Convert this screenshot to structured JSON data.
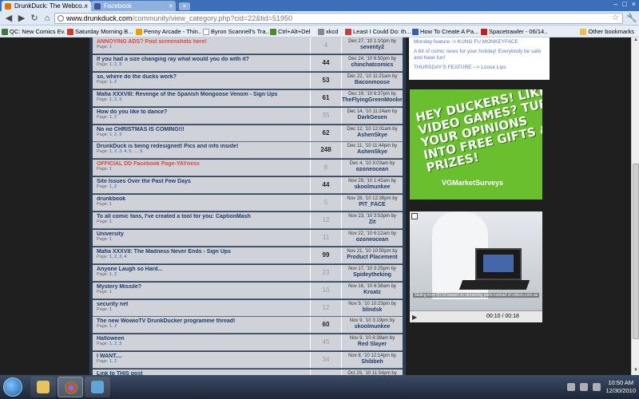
{
  "browser": {
    "tabs": [
      {
        "label": "DrunkDuck: The Webco...",
        "active": true
      },
      {
        "label": "Facebook",
        "active": false
      }
    ],
    "new_tab": "+",
    "url_host": "www.drunkduck.com",
    "url_path": "/community/view_category.php?cid=22&tid=51950"
  },
  "bookmarks": [
    {
      "label": "QC: New Comics Ev...",
      "color": "#3b7a3b"
    },
    {
      "label": "Saturday Morning B...",
      "color": "#d23a2a"
    },
    {
      "label": "Penny Arcade - Thin...",
      "color": "#e6a200"
    },
    {
      "label": "Byron Scannell's Tra...",
      "color": "#ffffff"
    },
    {
      "label": "Ctrl+Alt+Del",
      "color": "#4a8a2a"
    },
    {
      "label": "xkcd",
      "color": "#888888"
    },
    {
      "label": "Least I Could Do: th...",
      "color": "#c04040"
    },
    {
      "label": "How To Create A Pa...",
      "color": "#3a5fa8"
    },
    {
      "label": "Spacetrawler - 06/14...",
      "color": "#c02020"
    }
  ],
  "other_bookmarks": "Other bookmarks",
  "topics": [
    {
      "title": "ANNOYING ADS? Post screenshots here!",
      "red": true,
      "pages": [
        "1"
      ],
      "count": "4",
      "count_bold": false,
      "date": "Dec 27, '10 1:10pm by",
      "user": "seventy2"
    },
    {
      "title": "If you had a size changing ray what would you do with it?",
      "red": false,
      "pages": [
        "1",
        "2",
        "3"
      ],
      "count": "44",
      "count_bold": true,
      "date": "Dec 24, '10 6:50pm by",
      "user": "chinchatcomics"
    },
    {
      "title": "so, where do the ducks work?",
      "red": false,
      "pages": [
        "1",
        "2"
      ],
      "count": "53",
      "count_bold": true,
      "date": "Dec 22, '10 11:21am by",
      "user": "Baconmoose"
    },
    {
      "title": "Mafia XXXVIII: Revenge of the Spanish Mongoose Venom - Sign Ups",
      "red": false,
      "pages": [
        "1",
        "2",
        "3"
      ],
      "count": "61",
      "count_bold": true,
      "date": "Dec 19, '10 6:37pm by",
      "user": "TheFlyingGreenMonkey"
    },
    {
      "title": "How do you like to dance?",
      "red": false,
      "pages": [
        "1",
        "2"
      ],
      "count": "35",
      "count_bold": false,
      "date": "Dec 14, '10 11:24am by",
      "user": "DarkGesen"
    },
    {
      "title": "No no CHRISTMAS IS COMING!!!",
      "red": false,
      "pages": [
        "1",
        "2",
        "3"
      ],
      "count": "62",
      "count_bold": true,
      "date": "Dec 12, '10 12:01am by",
      "user": "AshenSkye"
    },
    {
      "title": "DrunkDuck is being redesigned! Pics and info inside!",
      "red": false,
      "pages": [
        "1",
        "2",
        "3",
        "4",
        "5",
        "...",
        "9"
      ],
      "count": "248",
      "count_bold": true,
      "date": "Dec 11, '10 11:44pm by",
      "user": "AshenSkye"
    },
    {
      "title": "OFFICIAL DD Facebook Page-YAYness",
      "red": true,
      "pages": [
        "1"
      ],
      "count": "8",
      "count_bold": false,
      "date": "Dec 4, '10 3:03am by",
      "user": "ozoneocean"
    },
    {
      "title": "Site Issues Over the Past Few Days",
      "red": false,
      "pages": [
        "1",
        "2"
      ],
      "count": "44",
      "count_bold": true,
      "date": "Nov 29, '10 1:42am by",
      "user": "skoolmunkee"
    },
    {
      "title": "drunkbook",
      "red": false,
      "pages": [
        "1"
      ],
      "count": "5",
      "count_bold": false,
      "date": "Nov 28, '10 12:38pm by",
      "user": "PIT_FACE"
    },
    {
      "title": "To all comic fans, I've created a tool for you: CaptionMash",
      "red": false,
      "pages": [
        "1"
      ],
      "count": "12",
      "count_bold": false,
      "date": "Nov 23, '10 3:53pm by",
      "user": "Zit"
    },
    {
      "title": "University",
      "red": false,
      "pages": [
        "1"
      ],
      "count": "11",
      "count_bold": false,
      "date": "Nov 22, '10 6:12am by",
      "user": "ozoneocean"
    },
    {
      "title": "Mafia XXXVII: The Madness Never Ends - Sign Ups",
      "red": false,
      "pages": [
        "1",
        "2",
        "3",
        "4"
      ],
      "count": "99",
      "count_bold": true,
      "date": "Nov 21, '10 10:50pm by",
      "user": "Product Placement"
    },
    {
      "title": "Anyone Laugh so Hard...",
      "red": false,
      "pages": [
        "1",
        "2"
      ],
      "count": "23",
      "count_bold": false,
      "date": "Nov 17, '10 3:25pm by",
      "user": "Spideytheking"
    },
    {
      "title": "Mystery Missile?",
      "red": false,
      "pages": [
        "1"
      ],
      "count": "10",
      "count_bold": false,
      "date": "Nov 16, '10 6:38am by",
      "user": "Kroatz"
    },
    {
      "title": "security net",
      "red": false,
      "pages": [
        "1"
      ],
      "count": "12",
      "count_bold": false,
      "date": "Nov 9, '10 10:23pm by",
      "user": "blindsk"
    },
    {
      "title": "The new WowioTV DrunkDucker programme thread!",
      "red": false,
      "pages": [
        "1",
        "2"
      ],
      "count": "60",
      "count_bold": true,
      "date": "Nov 9, '10 3:19pm by",
      "user": "skoolmunkee"
    },
    {
      "title": "Halloween",
      "red": false,
      "pages": [
        "1",
        "2",
        "3"
      ],
      "count": "45",
      "count_bold": false,
      "date": "Nov 9, '10 8:38am by",
      "user": "Red Slayer"
    },
    {
      "title": "I WANT....",
      "red": false,
      "pages": [
        "1",
        "2"
      ],
      "count": "34",
      "count_bold": false,
      "date": "Nov 8, '10 12:14pm by",
      "user": "Shibbeh"
    },
    {
      "title": "Link to THIS post",
      "red": false,
      "pages": [],
      "count": "",
      "count_bold": false,
      "date": "Oct 29, '10 11:54pm by",
      "user": ""
    }
  ],
  "pages_label": "Page:",
  "news": [
    "Monday feature -> KUNG FU MONKEYFACE",
    "A bit of comic news for your holiday! Everybody be safe and have fun!",
    "THURSDAY'S FEATURE --> Loose Lips"
  ],
  "ad": {
    "text": "HEY DUCKERS! LIKE VIDEO GAMES? TURN YOUR OPINIONS INTO FREE GIFTS & PRIZES!",
    "brand": "VGMarketSurveys"
  },
  "video": {
    "caption": "Sliding from 00:10 based on streaming parts instead of videos.com.au",
    "time": "00:10 / 00:18"
  },
  "clock": {
    "time": "10:50 AM",
    "date": "12/30/2010"
  }
}
